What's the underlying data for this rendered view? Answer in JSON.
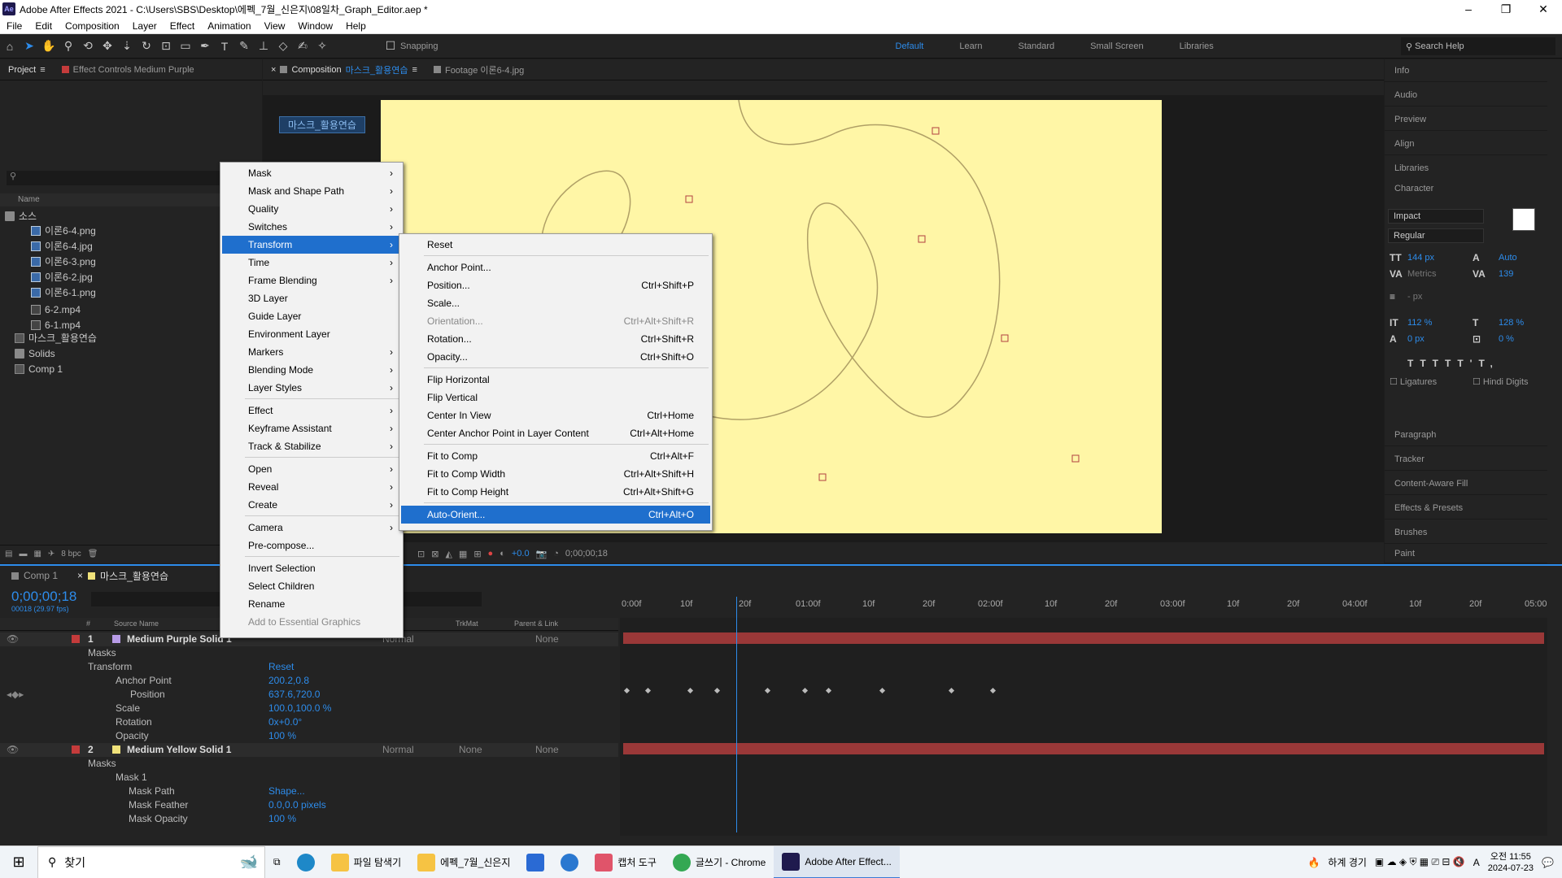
{
  "window": {
    "title": "Adobe After Effects 2021 - C:\\Users\\SBS\\Desktop\\에펙_7월_신은지\\08일차_Graph_Editor.aep *",
    "app_icon": "Ae",
    "minimize_label": "–",
    "maximize_label": "❐",
    "close_label": "✕"
  },
  "menubar": [
    "File",
    "Edit",
    "Composition",
    "Layer",
    "Effect",
    "Animation",
    "View",
    "Window",
    "Help"
  ],
  "toolbar": {
    "snapping_label": "Snapping",
    "workspaces": [
      "Default",
      "Learn",
      "Standard",
      "Small Screen",
      "Libraries"
    ],
    "active_workspace": "Default",
    "help_placeholder": "Search Help"
  },
  "project": {
    "tab_project": "Project",
    "tab_effect_controls": "Effect Controls Medium Purple",
    "col_name": "Name",
    "items": [
      {
        "label": "소스",
        "type": "folder"
      },
      {
        "label": "이론6-4.png",
        "type": "file"
      },
      {
        "label": "이론6-4.jpg",
        "type": "file"
      },
      {
        "label": "이론6-3.png",
        "type": "file"
      },
      {
        "label": "이론6-2.jpg",
        "type": "file"
      },
      {
        "label": "이론6-1.png",
        "type": "file"
      },
      {
        "label": "6-2.mp4",
        "type": "video"
      },
      {
        "label": "6-1.mp4",
        "type": "video"
      },
      {
        "label": "마스크_활용연습",
        "type": "comp"
      },
      {
        "label": "Solids",
        "type": "folder"
      },
      {
        "label": "Comp 1",
        "type": "comp"
      }
    ],
    "bpc": "8 bpc"
  },
  "composition": {
    "tab_label": "Composition",
    "tab_name": "마스크_활용연습",
    "footage_tab": "Footage 이론6-4.jpg",
    "view_label": "마스크_활용연습",
    "exposure": "+0.0",
    "timecode": "0;00;00;18",
    "bg_color": "#fff6a6"
  },
  "right_panel": {
    "items": [
      "Info",
      "Audio",
      "Preview",
      "Align",
      "Libraries",
      "Character"
    ],
    "bottom_items": [
      "Paragraph",
      "Tracker",
      "Content-Aware Fill",
      "Effects & Presets",
      "Brushes",
      "Paint"
    ],
    "character": {
      "font": "Impact",
      "style": "Regular",
      "size": "144 px",
      "leading": "Auto",
      "kerning": "Metrics",
      "tracking": "139",
      "stroke": "- px",
      "vscale": "112 %",
      "hscale": "128 %",
      "baseline": "0 px",
      "tsume": "0 %",
      "ligatures": "Ligatures",
      "hindi": "Hindi Digits"
    }
  },
  "timeline": {
    "tab_comp1": "Comp 1",
    "tab_active": "마스크_활용연습",
    "timecode": "0;00;00;18",
    "fps": "00018 (29.97 fps)",
    "cols": {
      "source": "Source Name",
      "trkmat": "TrkMat",
      "parent": "Parent & Link",
      "hash": "#"
    },
    "layer1": {
      "num": "1",
      "name": "Medium Purple Solid 1",
      "mode": "Normal",
      "parent": "None",
      "color": "#b79be6"
    },
    "masks_label": "Masks",
    "transform_label": "Transform",
    "reset_label": "Reset",
    "anchor_label": "Anchor Point",
    "anchor_value": "200.2,0.8",
    "position_label": "Position",
    "position_value": "637.6,720.0",
    "scale_label": "Scale",
    "scale_value": "100.0,100.0 %",
    "rotation_label": "Rotation",
    "rotation_value": "0x+0.0°",
    "opacity_label": "Opacity",
    "opacity_value": "100 %",
    "layer2": {
      "num": "2",
      "name": "Medium Yellow Solid 1",
      "mode": "Normal",
      "trkmat": "None",
      "parent": "None",
      "color": "#f0e27a"
    },
    "mask1_label": "Mask 1",
    "mask_path_label": "Mask Path",
    "mask_path_value": "Shape...",
    "mask_feather_label": "Mask Feather",
    "mask_feather_value": "0.0,0.0 pixels",
    "mask_opacity_label": "Mask Opacity",
    "mask_opacity_value": "100 %",
    "ruler": [
      "0:00f",
      "10f",
      "20f",
      "01:00f",
      "10f",
      "20f",
      "02:00f",
      "10f",
      "20f",
      "03:00f",
      "10f",
      "20f",
      "04:00f",
      "10f",
      "20f",
      "05:00"
    ]
  },
  "context_menu": {
    "items": [
      {
        "label": "Mask",
        "arrow": "›"
      },
      {
        "label": "Mask and Shape Path",
        "arrow": "›"
      },
      {
        "label": "Quality",
        "arrow": "›"
      },
      {
        "label": "Switches",
        "arrow": "›"
      },
      {
        "label": "Transform",
        "arrow": "›"
      },
      {
        "label": "Time",
        "arrow": "›"
      },
      {
        "label": "Frame Blending",
        "arrow": "›"
      },
      {
        "label": "3D Layer"
      },
      {
        "label": "Guide Layer"
      },
      {
        "label": "Environment Layer"
      },
      {
        "label": "Markers",
        "arrow": "›"
      },
      {
        "label": "Blending Mode",
        "arrow": "›"
      },
      {
        "label": "Layer Styles",
        "arrow": "›"
      },
      {
        "label": "Effect",
        "arrow": "›"
      },
      {
        "label": "Keyframe Assistant",
        "arrow": "›"
      },
      {
        "label": "Track & Stabilize",
        "arrow": "›"
      },
      {
        "label": "Open",
        "arrow": "›"
      },
      {
        "label": "Reveal",
        "arrow": "›"
      },
      {
        "label": "Create",
        "arrow": "›"
      },
      {
        "label": "Camera",
        "arrow": "›"
      },
      {
        "label": "Pre-compose..."
      },
      {
        "label": "Invert Selection"
      },
      {
        "label": "Select Children"
      },
      {
        "label": "Rename"
      },
      {
        "label": "Add to Essential Graphics"
      }
    ],
    "highlighted": "Transform",
    "disabled": "Add to Essential Graphics"
  },
  "submenu": {
    "items": [
      {
        "label": "Reset",
        "shortcut": ""
      },
      {
        "label": "Anchor Point...",
        "shortcut": ""
      },
      {
        "label": "Position...",
        "shortcut": "Ctrl+Shift+P"
      },
      {
        "label": "Scale...",
        "shortcut": ""
      },
      {
        "label": "Orientation...",
        "shortcut": "Ctrl+Alt+Shift+R"
      },
      {
        "label": "Rotation...",
        "shortcut": "Ctrl+Shift+R"
      },
      {
        "label": "Opacity...",
        "shortcut": "Ctrl+Shift+O"
      },
      {
        "label": "Flip Horizontal",
        "shortcut": ""
      },
      {
        "label": "Flip Vertical",
        "shortcut": ""
      },
      {
        "label": "Center In View",
        "shortcut": "Ctrl+Home"
      },
      {
        "label": "Center Anchor Point in Layer Content",
        "shortcut": "Ctrl+Alt+Home"
      },
      {
        "label": "Fit to Comp",
        "shortcut": "Ctrl+Alt+F"
      },
      {
        "label": "Fit to Comp Width",
        "shortcut": "Ctrl+Alt+Shift+H"
      },
      {
        "label": "Fit to Comp Height",
        "shortcut": "Ctrl+Alt+Shift+G"
      },
      {
        "label": "Auto-Orient...",
        "shortcut": "Ctrl+Alt+O"
      }
    ],
    "highlighted": "Auto-Orient...",
    "disabled": "Orientation..."
  },
  "taskbar": {
    "search_placeholder": "찾기",
    "apps": [
      {
        "label": "파일 탐색기",
        "color": "#f6c343"
      },
      {
        "label": "에펙_7월_신은지",
        "color": "#f6c343"
      },
      {
        "label": "캡처 도구",
        "color": "#e0546a"
      },
      {
        "label": "글쓰기 - Chrome",
        "color": "#34a853"
      },
      {
        "label": "Adobe After Effect...",
        "color": "#1f1a4e"
      }
    ],
    "weather": "하계 경기",
    "time": "오전 11:55",
    "date": "2024-07-23",
    "ime": "A"
  }
}
